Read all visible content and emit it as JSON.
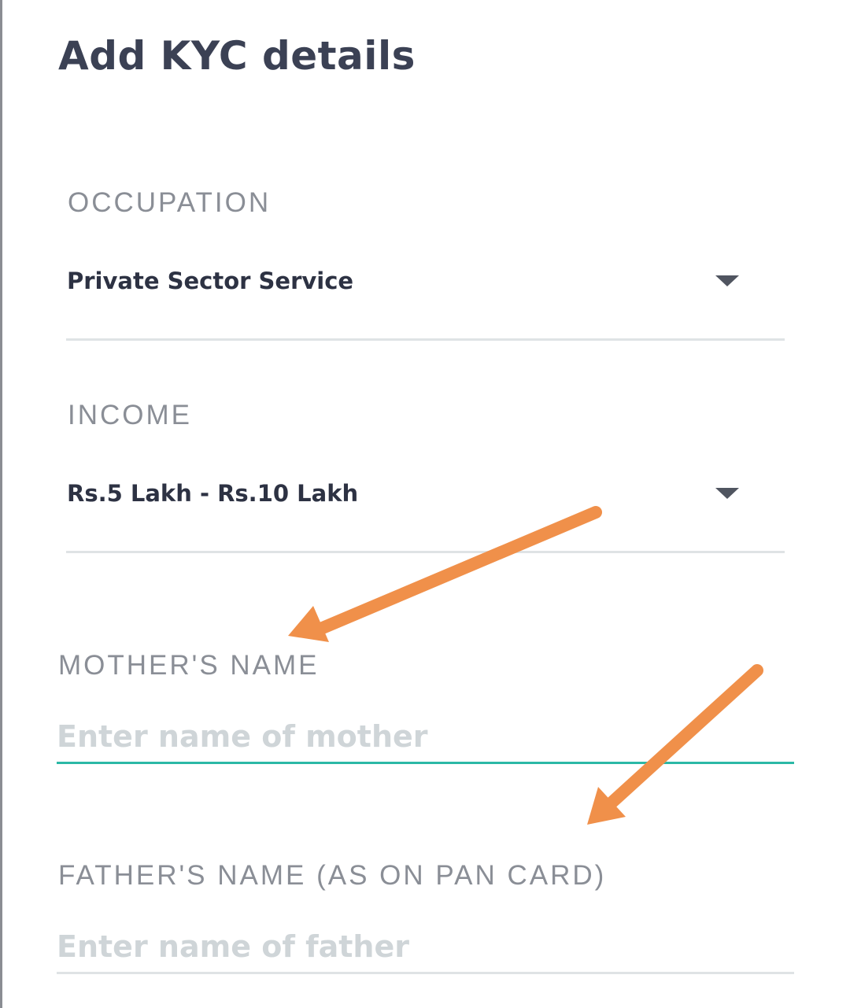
{
  "page": {
    "title": "Add KYC details"
  },
  "occupation": {
    "label": "OCCUPATION",
    "value": "Private Sector Service",
    "icon": "chevron-down-icon"
  },
  "income": {
    "label": "INCOME",
    "value": "Rs.5 Lakh - Rs.10 Lakh",
    "icon": "chevron-down-icon"
  },
  "mother": {
    "label": "MOTHER'S NAME",
    "placeholder": "Enter name of mother",
    "value": ""
  },
  "father": {
    "label": "FATHER'S NAME (AS ON PAN CARD)",
    "placeholder": "Enter name of father",
    "value": ""
  },
  "colors": {
    "text": "#3b4154",
    "label": "#8a8e96",
    "focus_underline": "#2bb8a6",
    "annotation_arrow": "#f0904a"
  }
}
